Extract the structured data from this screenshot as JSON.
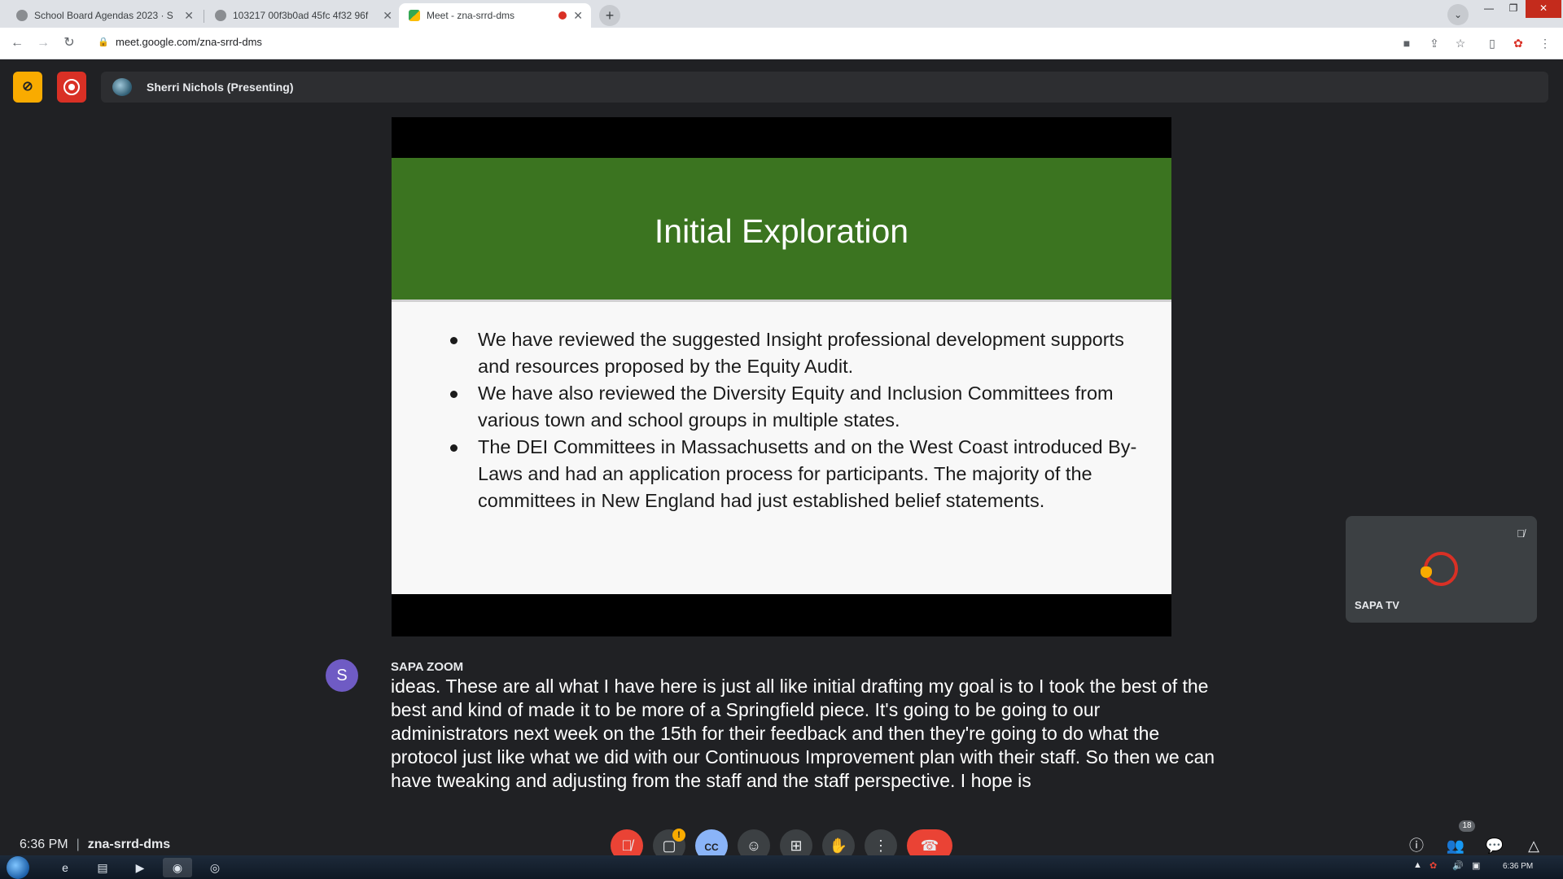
{
  "browser": {
    "tabs": [
      {
        "title": "School Board Agendas 2023 · S"
      },
      {
        "title": "103217 00f3b0ad 45fc 4f32 96f"
      },
      {
        "title": "Meet - zna-srrd-dms"
      }
    ],
    "url": "meet.google.com/zna-srrd-dms"
  },
  "meet": {
    "presenter": "Sherri Nichols (Presenting)",
    "slide": {
      "title": "Initial Exploration",
      "bullets": [
        "We have reviewed the suggested Insight professional development supports and resources proposed by the Equity Audit.",
        "We have also reviewed the Diversity Equity and Inclusion Committees from various town and school groups in multiple states.",
        "The DEI Committees in Massachusetts and on the West Coast introduced By-Laws and had an application process for participants. The majority of the committees in New England had just established belief statements."
      ],
      "title_band_color": "#3b7420"
    },
    "self_tile": {
      "name": "SAPA TV"
    },
    "caption": {
      "avatar_letter": "S",
      "speaker": "SAPA ZOOM",
      "text": "ideas. These are all what I have here is just all like initial drafting my goal is to I took the best of the best and kind of made it to be more of a Springfield piece. It's going to be going to our administrators next week on the 15th for their feedback and then they're going to do what the protocol just like what we did with our Continuous Improvement plan with their staff. So then we can have tweaking and adjusting from the staff and the staff perspective. I hope is"
    },
    "bottom": {
      "time": "6:36 PM",
      "meeting_code": "zna-srrd-dms",
      "activity_badge": "!",
      "people_count": "18"
    },
    "icons": {
      "mic_off": "mic-off-icon",
      "camera_off": "camera-off-icon",
      "captions": "captions-icon",
      "emoji": "emoji-icon",
      "present": "present-icon",
      "raise_hand": "raise-hand-icon",
      "more": "more-options-icon",
      "hangup": "hangup-icon",
      "info": "info-icon",
      "people": "people-icon",
      "chat": "chat-icon",
      "activities": "activities-icon"
    }
  },
  "taskbar": {
    "clock": "6:36 PM"
  }
}
